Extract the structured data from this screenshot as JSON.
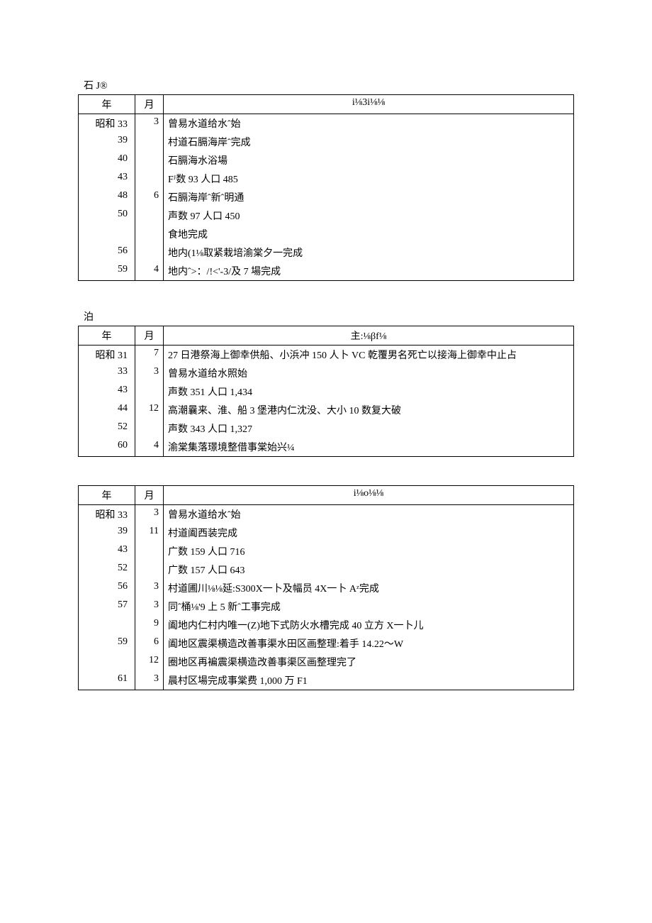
{
  "sections": [
    {
      "title": "石 J®",
      "header": {
        "year": "年",
        "month": "月",
        "desc": "i⅛3i⅛⅛"
      },
      "rows": [
        {
          "year": "昭和 33",
          "month": "3",
          "desc": "曾易水道给水ˆ始"
        },
        {
          "year": "39",
          "month": "",
          "desc": "村道石膈海岸ˆ完成"
        },
        {
          "year": "40",
          "month": "",
          "desc": "石膈海水浴場"
        },
        {
          "year": "43",
          "month": "",
          "desc": "Fᴶ数 93 人口 485"
        },
        {
          "year": "48",
          "month": "6",
          "desc": "石膈海岸ˆ新ˆ明通"
        },
        {
          "year": "50",
          "month": "",
          "desc": "声数 97 人口 450"
        },
        {
          "year": "",
          "month": "",
          "desc": "食地完成"
        },
        {
          "year": "56",
          "month": "",
          "desc": "地内(1⅛取紧栽培渝棠夕一完成"
        },
        {
          "year": "59",
          "month": "4",
          "desc": "地内ˆ>：/!<'-3/及 7 場完成"
        }
      ]
    },
    {
      "title": "泊",
      "header": {
        "year": "年",
        "month": "月",
        "desc": "主:⅛βf⅛"
      },
      "rows": [
        {
          "year": "昭和 31",
          "month": "7",
          "desc": "27 日港祭海上御幸供船、小浜冲 150 人卜 VC 乾覆男名死亡以接海上御幸中止占"
        },
        {
          "year": "33",
          "month": "3",
          "desc": "曾易水道给水照始"
        },
        {
          "year": "43",
          "month": "",
          "desc": "声数 351 人口 1,434"
        },
        {
          "year": "44",
          "month": "12",
          "desc": "高潮曩来、淮、船 3 堡港内仁沈没、大小 10 数复大破"
        },
        {
          "year": "52",
          "month": "",
          "desc": "声数 343 人口 1,327"
        },
        {
          "year": "60",
          "month": "4",
          "desc": "渝棠集落璟境整借事棠始兴¼"
        }
      ]
    },
    {
      "title": "",
      "header": {
        "year": "年",
        "month": "月",
        "desc": "i⅛o⅛⅛"
      },
      "rows": [
        {
          "year": "昭和 33",
          "month": "3",
          "desc": "曾易水道给水ˆ始"
        },
        {
          "year": "39",
          "month": "11",
          "desc": "村道阖西装完成"
        },
        {
          "year": "43",
          "month": "",
          "desc": "广数 159 人口 716"
        },
        {
          "year": "52",
          "month": "",
          "desc": "广数 157 人口 643"
        },
        {
          "year": "56",
          "month": "3",
          "desc": "村道圃川⅛⅛延:S300X一卜及幅员 4X一卜 Aᶻ完成"
        },
        {
          "year": "57",
          "month": "3",
          "desc": "同ˆ桶⅛'9 上 5 新ˆ工事完成"
        },
        {
          "year": "",
          "month": "9",
          "desc": "阖地内仁村内唯一(Z)地下式防火水槽完成 40 立方 X一卜儿"
        },
        {
          "year": "59",
          "month": "6",
          "desc": "阖地区震渠横造改善事渠水田区画整理:着手 14.22～W"
        },
        {
          "year": "",
          "month": "12",
          "desc": "圈地区再褊震渠横造改善事渠区画整理完了"
        },
        {
          "year": "61",
          "month": "3",
          "desc": "晨村区場完成事棠费 1,000 万 F1"
        }
      ]
    }
  ]
}
